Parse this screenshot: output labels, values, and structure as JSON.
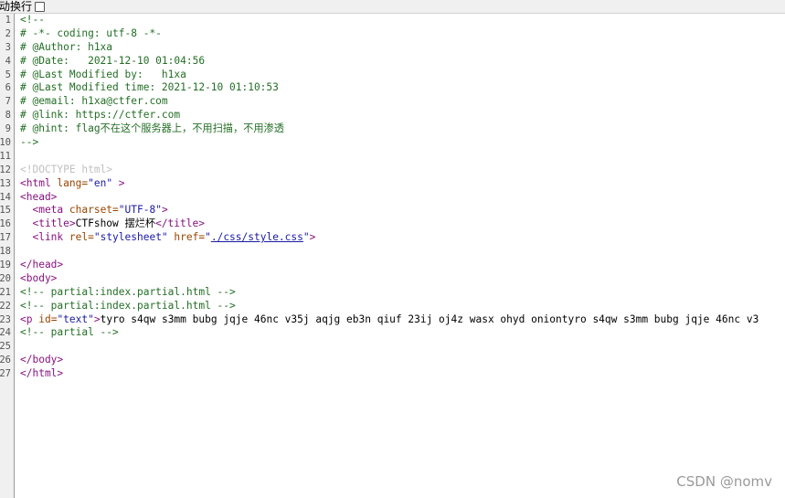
{
  "toolbar": {
    "wrap_label": "动换行"
  },
  "watermark": "CSDN @nomv",
  "lines": [
    {
      "n": "1",
      "t": "<!--"
    },
    {
      "n": "2",
      "t": "# -*- coding: utf-8 -*-"
    },
    {
      "n": "3",
      "t": "# @Author: h1xa"
    },
    {
      "n": "4",
      "t": "# @Date:   2021-12-10 01:04:56"
    },
    {
      "n": "5",
      "t": "# @Last Modified by:   h1xa"
    },
    {
      "n": "6",
      "t": "# @Last Modified time: 2021-12-10 01:10:53"
    },
    {
      "n": "7",
      "t": "# @email: h1xa@ctfer.com"
    },
    {
      "n": "8",
      "t": "# @link: https://ctfer.com"
    },
    {
      "n": "9",
      "t": "# @hint: flag不在这个服务器上，不用扫描，不用渗透"
    },
    {
      "n": "10",
      "t": "-->"
    },
    {
      "n": "11",
      "t": ""
    },
    {
      "n": "12",
      "t": "<!DOCTYPE html>"
    },
    {
      "n": "13",
      "a": "<html ",
      "b": "lang=",
      "c": "\"en\"",
      "d": " >"
    },
    {
      "n": "14",
      "t": "<head>"
    },
    {
      "n": "15",
      "a": "  <meta ",
      "b": "charset=",
      "c": "\"UTF-8\"",
      "d": ">"
    },
    {
      "n": "16",
      "a": "  <title>",
      "x": "CTFshow 摆烂杯",
      "d": "</title>"
    },
    {
      "n": "17",
      "a": "  <link ",
      "b": "rel=",
      "c": "\"stylesheet\"",
      "b2": " href=",
      "c2": "\"",
      "l": "./css/style.css",
      "c3": "\"",
      "d": ">"
    },
    {
      "n": "18",
      "t": ""
    },
    {
      "n": "19",
      "t": "</head>"
    },
    {
      "n": "20",
      "t": "<body>"
    },
    {
      "n": "21",
      "t": "<!-- partial:index.partial.html -->"
    },
    {
      "n": "22",
      "t": "<!-- partial:index.partial.html -->"
    },
    {
      "n": "23",
      "a": "<p ",
      "b": "id=",
      "c": "\"text\"",
      "d": ">",
      "x": "tyro s4qw s3mm bubg jqje 46nc v35j aqjg eb3n qiuf 23ij oj4z wasx ohyd oniontyro s4qw s3mm bubg jqje 46nc v3"
    },
    {
      "n": "24",
      "t": "<!-- partial -->"
    },
    {
      "n": "25",
      "t": ""
    },
    {
      "n": "26",
      "t": "</body>"
    },
    {
      "n": "27",
      "t": "</html>"
    }
  ]
}
